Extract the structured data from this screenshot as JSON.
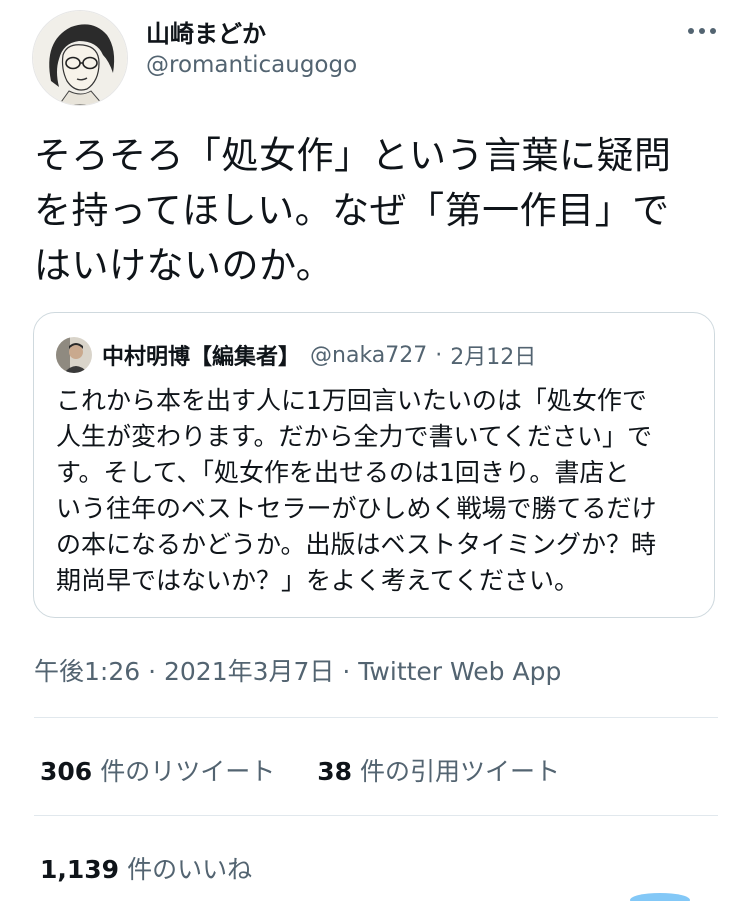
{
  "author": {
    "display_name": "山崎まどか",
    "handle": "@romanticaugogo",
    "avatar_icon": "illustrated-woman-avatar"
  },
  "tweet": {
    "lines": [
      "そろそろ「処女作」という言葉に疑問",
      "を持ってほしい。なぜ「第一作目」で",
      "はいけないのか。"
    ]
  },
  "quote": {
    "name": "中村明博【編集者】",
    "handle": "@naka727",
    "separator": "·",
    "date": "2月12日",
    "lines": [
      "これから本を出す人に1万回言いたいのは「処女作で",
      "人生が変わります。だから全力で書いてください」で",
      "す。そして、「処女作を出せるのは1回きり。書店と",
      "いう往年のベストセラーがひしめく戦場で勝てるだけ",
      "の本になるかどうか。出版はベストタイミングか？時",
      "期尚早ではないか？」をよく考えてください。"
    ]
  },
  "meta": {
    "time": "午後1:26",
    "sep1": "·",
    "date": "2021年3月7日",
    "sep2": "·",
    "source": "Twitter Web App"
  },
  "stats": {
    "retweets_count": "306",
    "retweets_label": "件のリツイート",
    "quotes_count": "38",
    "quotes_label": "件の引用ツイート",
    "likes_count": "1,139",
    "likes_label": "件のいいね"
  },
  "colors": {
    "text_primary": "#0f1419",
    "text_secondary": "#536471",
    "border": "#cfd9de",
    "accent": "#1d9bf0"
  }
}
